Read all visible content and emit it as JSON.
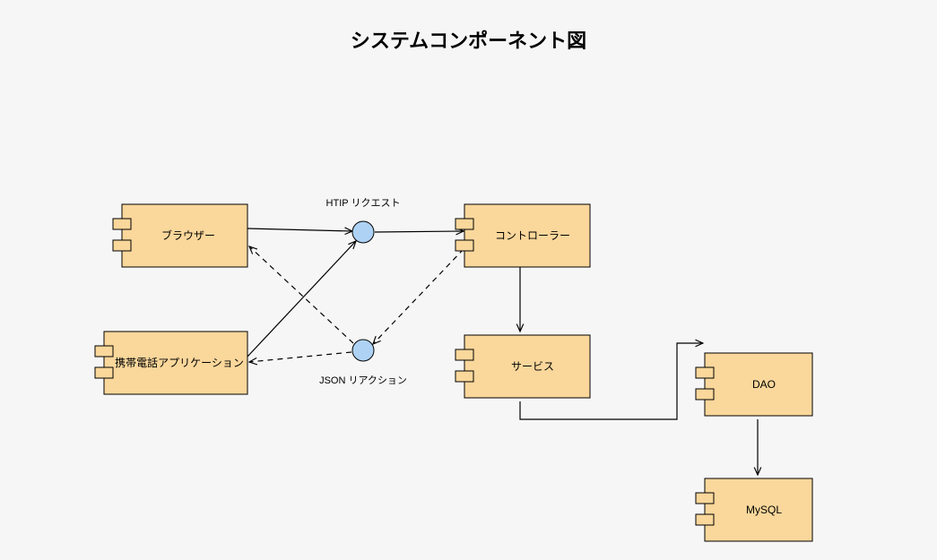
{
  "title": "システムコンポーネント図",
  "components": {
    "browser": {
      "label": "ブラウザー"
    },
    "mobile": {
      "label": "携帯電話アプリケーション"
    },
    "controller": {
      "label": "コントローラー"
    },
    "service": {
      "label": "サービス"
    },
    "dao": {
      "label": "DAO"
    },
    "mysql": {
      "label": "MySQL"
    }
  },
  "interfaces": {
    "http_request": {
      "label": "HTIP リクエスト"
    },
    "json_reaction": {
      "label": "JSON リアクション"
    }
  },
  "diagram": {
    "type": "uml_component_diagram",
    "nodes": [
      {
        "id": "browser",
        "kind": "component"
      },
      {
        "id": "mobile",
        "kind": "component"
      },
      {
        "id": "controller",
        "kind": "component"
      },
      {
        "id": "service",
        "kind": "component"
      },
      {
        "id": "dao",
        "kind": "component"
      },
      {
        "id": "mysql",
        "kind": "component"
      },
      {
        "id": "http_request",
        "kind": "interface"
      },
      {
        "id": "json_reaction",
        "kind": "interface"
      }
    ],
    "edges": [
      {
        "from": "browser",
        "to": "http_request",
        "style": "solid"
      },
      {
        "from": "mobile",
        "to": "http_request",
        "style": "solid"
      },
      {
        "from": "http_request",
        "to": "controller",
        "style": "solid"
      },
      {
        "from": "controller",
        "to": "json_reaction",
        "style": "dashed"
      },
      {
        "from": "json_reaction",
        "to": "browser",
        "style": "dashed"
      },
      {
        "from": "json_reaction",
        "to": "mobile",
        "style": "dashed"
      },
      {
        "from": "controller",
        "to": "service",
        "style": "solid"
      },
      {
        "from": "service",
        "to": "dao",
        "style": "solid",
        "routing": "orthogonal"
      },
      {
        "from": "dao",
        "to": "mysql",
        "style": "solid"
      }
    ]
  }
}
